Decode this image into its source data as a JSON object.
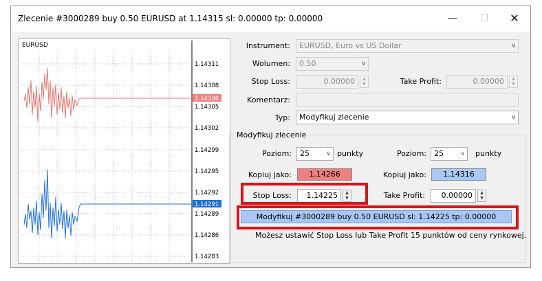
{
  "window": {
    "title": "Zlecenie #3000289 buy 0.50 EURUSD at 1.14315 sl: 0.00000 tp: 0.00000",
    "minimize_glyph": "—",
    "maximize_glyph": "☐",
    "close_glyph": "✕"
  },
  "chart": {
    "symbol": "EURUSD",
    "price_labels": [
      "1.14311",
      "1.14308",
      "1.14305",
      "1.14302",
      "1.14299",
      "1.14295",
      "1.14292",
      "1.14289",
      "1.14286",
      "1.14283"
    ],
    "sl_marker": "1.14306",
    "sl_color": "#f08080",
    "ask_marker": "1.14291",
    "ask_color": "#1f6fd6"
  },
  "form": {
    "instrument_label": "Instrument:",
    "instrument_value": "EURUSD, Euro vs US Dollar",
    "volume_label": "Wolumen:",
    "volume_value": "0.50",
    "stoploss_label": "Stop Loss:",
    "stoploss_value": "0.00000",
    "takeprofit_label": "Take Profit:",
    "takeprofit_value": "0.00000",
    "comment_label": "Komentarz:",
    "comment_value": "",
    "type_label": "Typ:",
    "type_value": "Modyfikuj zlecenie"
  },
  "modify": {
    "group_title": "Modyfikuj zlecenie",
    "level_label_left": "Poziom:",
    "level_value_left": "25",
    "points_left": "punkty",
    "level_label_right": "Poziom:",
    "level_value_right": "25",
    "points_right": "punkty",
    "copy_label_left": "Kopiuj jako:",
    "copy_value_left": "1.14266",
    "copy_label_right": "Kopiuj jako:",
    "copy_value_right": "1.14316",
    "sl_label": "Stop Loss:",
    "sl_value": "1.14225",
    "tp_label": "Take Profit:",
    "tp_value": "0.00000",
    "modify_button": "Modyfikuj #3000289 buy 0.50 EURUSD sl: 1.14225 tp: 0.00000",
    "note": "Możesz ustawić Stop Loss lub Take Profit  15 punktów od ceny rynkowej."
  },
  "colors": {
    "highlight": "#d9141b",
    "copy_red": "#f08080",
    "copy_blue": "#aac8f5"
  }
}
